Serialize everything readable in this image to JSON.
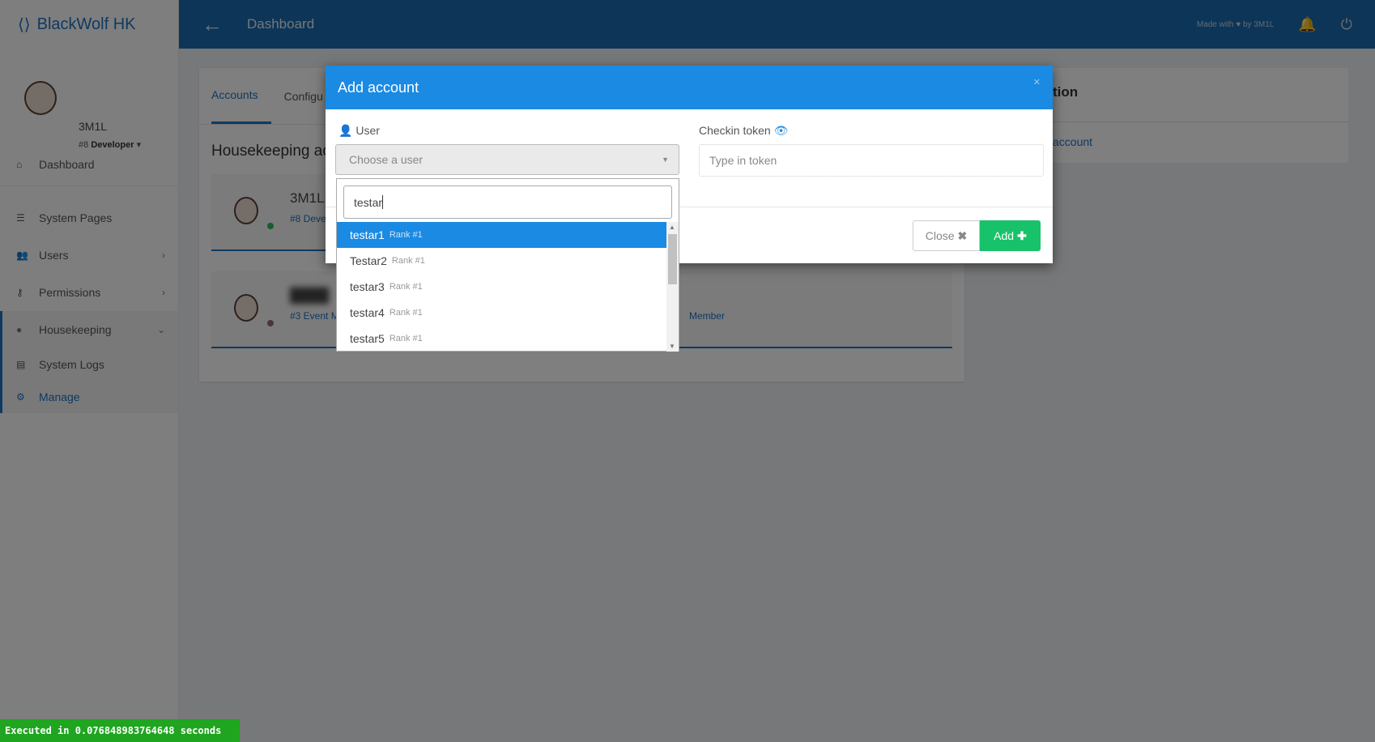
{
  "sidebar": {
    "brand": "BlackWolf HK",
    "user": {
      "name": "3M1L",
      "rank": "#8",
      "role": "Developer"
    },
    "items": [
      {
        "label": "Dashboard",
        "icon": "home-icon"
      },
      {
        "label": "System Pages",
        "icon": "list-icon"
      },
      {
        "label": "Users",
        "icon": "users-icon"
      },
      {
        "label": "Permissions",
        "icon": "key-icon"
      },
      {
        "label": "Housekeeping",
        "icon": "gear-icon"
      },
      {
        "label": "System Logs",
        "icon": "file-icon"
      },
      {
        "label": "Manage",
        "icon": "cog-icon"
      }
    ]
  },
  "header": {
    "title": "Dashboard",
    "made_with": "Made with ♥ by 3M1L"
  },
  "main": {
    "tabs": [
      {
        "label": "Accounts"
      },
      {
        "label": "Configu"
      }
    ],
    "title": "Housekeeping ac",
    "accounts": [
      {
        "name": "3M1L",
        "rank": "#8 Deve",
        "status": "online"
      },
      {
        "name": "",
        "rank": "#3 Event M",
        "extra": "Member",
        "status": "offline"
      }
    ],
    "right_card": {
      "title": "tion",
      "link": "account"
    }
  },
  "modal": {
    "title": "Add account",
    "user_label": "User",
    "user_placeholder": "Choose a user",
    "token_label": "Checkin token",
    "token_placeholder": "Type in token",
    "close_label": "Close",
    "add_label": "Add",
    "search_value": "testar",
    "options": [
      {
        "name": "testar1",
        "rank": "Rank #1"
      },
      {
        "name": "Testar2",
        "rank": "Rank #1"
      },
      {
        "name": "testar3",
        "rank": "Rank #1"
      },
      {
        "name": "testar4",
        "rank": "Rank #1"
      },
      {
        "name": "testar5",
        "rank": "Rank #1"
      }
    ]
  },
  "footer": {
    "executed": "Executed in 0.076848983764648 seconds"
  },
  "colors": {
    "primary": "#1a8ae3",
    "success": "#18c26b",
    "header": "#1a6bb0"
  }
}
